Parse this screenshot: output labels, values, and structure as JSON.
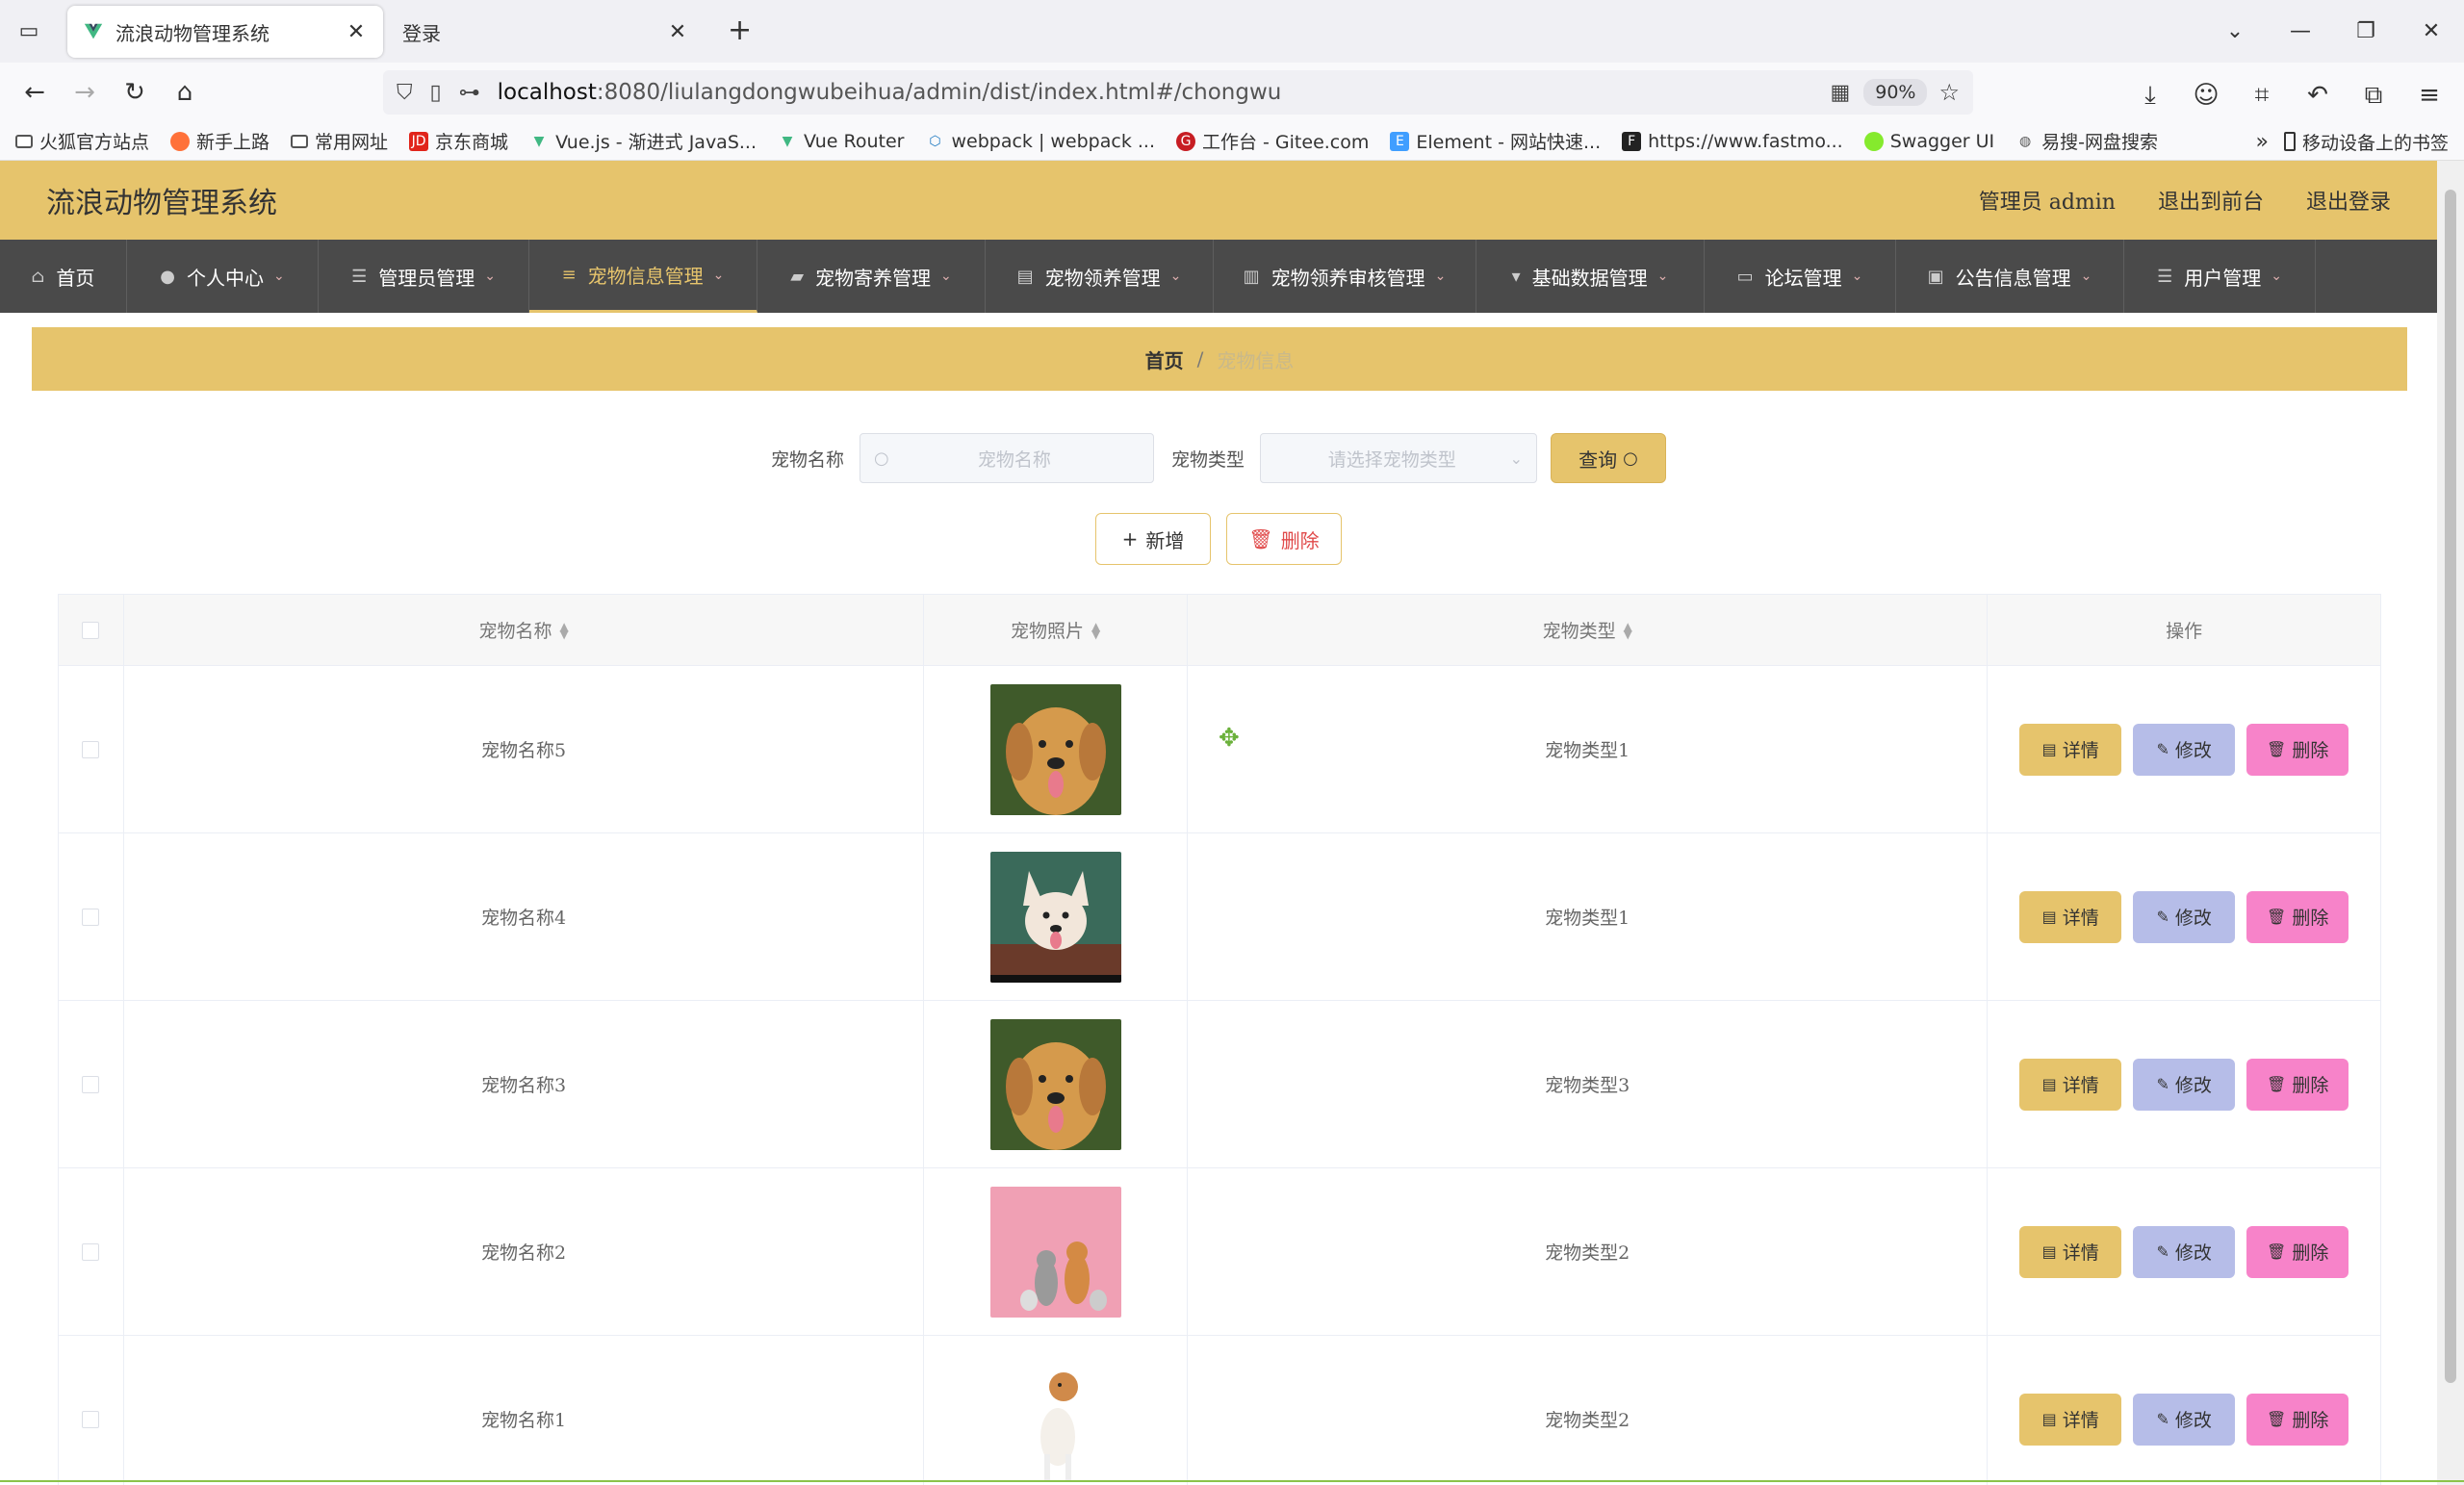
{
  "browser": {
    "tabs": [
      {
        "title": "流浪动物管理系统",
        "active": true
      },
      {
        "title": "登录",
        "active": false
      }
    ],
    "url_host": "localhost",
    "url_path": ":8080/liulangdongwubeihua/admin/dist/index.html#/chongwu",
    "zoom": "90%",
    "bookmarks": [
      {
        "label": "火狐官方站点",
        "icon": "folder-icon"
      },
      {
        "label": "新手上路",
        "icon": "firefox-icon"
      },
      {
        "label": "常用网址",
        "icon": "folder-icon"
      },
      {
        "label": "京东商城",
        "icon": "jd-icon"
      },
      {
        "label": "Vue.js - 渐进式 JavaS...",
        "icon": "vue-icon"
      },
      {
        "label": "Vue Router",
        "icon": "vue-icon"
      },
      {
        "label": "webpack | webpack ...",
        "icon": "webpack-icon"
      },
      {
        "label": "工作台 - Gitee.com",
        "icon": "gitee-icon"
      },
      {
        "label": "Element - 网站快速...",
        "icon": "element-icon"
      },
      {
        "label": "https://www.fastmo...",
        "icon": "fastmock-icon"
      },
      {
        "label": "Swagger UI",
        "icon": "swagger-icon"
      },
      {
        "label": "易搜-网盘搜索",
        "icon": "globe-icon"
      }
    ],
    "mobile_bookmarks": "移动设备上的书签"
  },
  "app": {
    "title": "流浪动物管理系统",
    "header_links": [
      "管理员 admin",
      "退出到前台",
      "退出登录"
    ],
    "menu": [
      {
        "label": "首页",
        "icon": "home-icon",
        "has_arrow": false
      },
      {
        "label": "个人中心",
        "icon": "user-icon",
        "has_arrow": true
      },
      {
        "label": "管理员管理",
        "icon": "sliders-icon",
        "has_arrow": true
      },
      {
        "label": "宠物信息管理",
        "icon": "list-icon",
        "has_arrow": true,
        "active": true
      },
      {
        "label": "宠物寄养管理",
        "icon": "ticket-icon",
        "has_arrow": true
      },
      {
        "label": "宠物领养管理",
        "icon": "clipboard-icon",
        "has_arrow": true
      },
      {
        "label": "宠物领养审核管理",
        "icon": "chart-icon",
        "has_arrow": true
      },
      {
        "label": "基础数据管理",
        "icon": "stamp-icon",
        "has_arrow": true
      },
      {
        "label": "论坛管理",
        "icon": "laptop-icon",
        "has_arrow": true
      },
      {
        "label": "公告信息管理",
        "icon": "briefcase-icon",
        "has_arrow": true
      },
      {
        "label": "用户管理",
        "icon": "menu-icon",
        "has_arrow": true
      }
    ],
    "breadcrumb": {
      "home": "首页",
      "separator": "/",
      "current": "宠物信息"
    },
    "search": {
      "name_label": "宠物名称",
      "name_placeholder": "宠物名称",
      "type_label": "宠物类型",
      "type_placeholder": "请选择宠物类型",
      "query_button": "查询"
    },
    "actions": {
      "add": "新增",
      "delete": "删除"
    },
    "table": {
      "headers": [
        "宠物名称",
        "宠物照片",
        "宠物类型",
        "操作"
      ],
      "rows": [
        {
          "name": "宠物名称5",
          "type": "宠物类型1",
          "photo": "golden-retriever"
        },
        {
          "name": "宠物名称4",
          "type": "宠物类型1",
          "photo": "corgi"
        },
        {
          "name": "宠物名称3",
          "type": "宠物类型3",
          "photo": "golden-retriever"
        },
        {
          "name": "宠物名称2",
          "type": "宠物类型2",
          "photo": "dogs-and-cats-pink"
        },
        {
          "name": "宠物名称1",
          "type": "宠物类型2",
          "photo": "jack-russell"
        }
      ],
      "row_buttons": {
        "detail": "详情",
        "edit": "修改",
        "delete": "删除"
      }
    },
    "colors": {
      "accent": "#e6c46c",
      "menu_bg": "#4a4a4a",
      "edit_btn": "#b6bde8",
      "delete_btn": "#f783c9"
    }
  }
}
